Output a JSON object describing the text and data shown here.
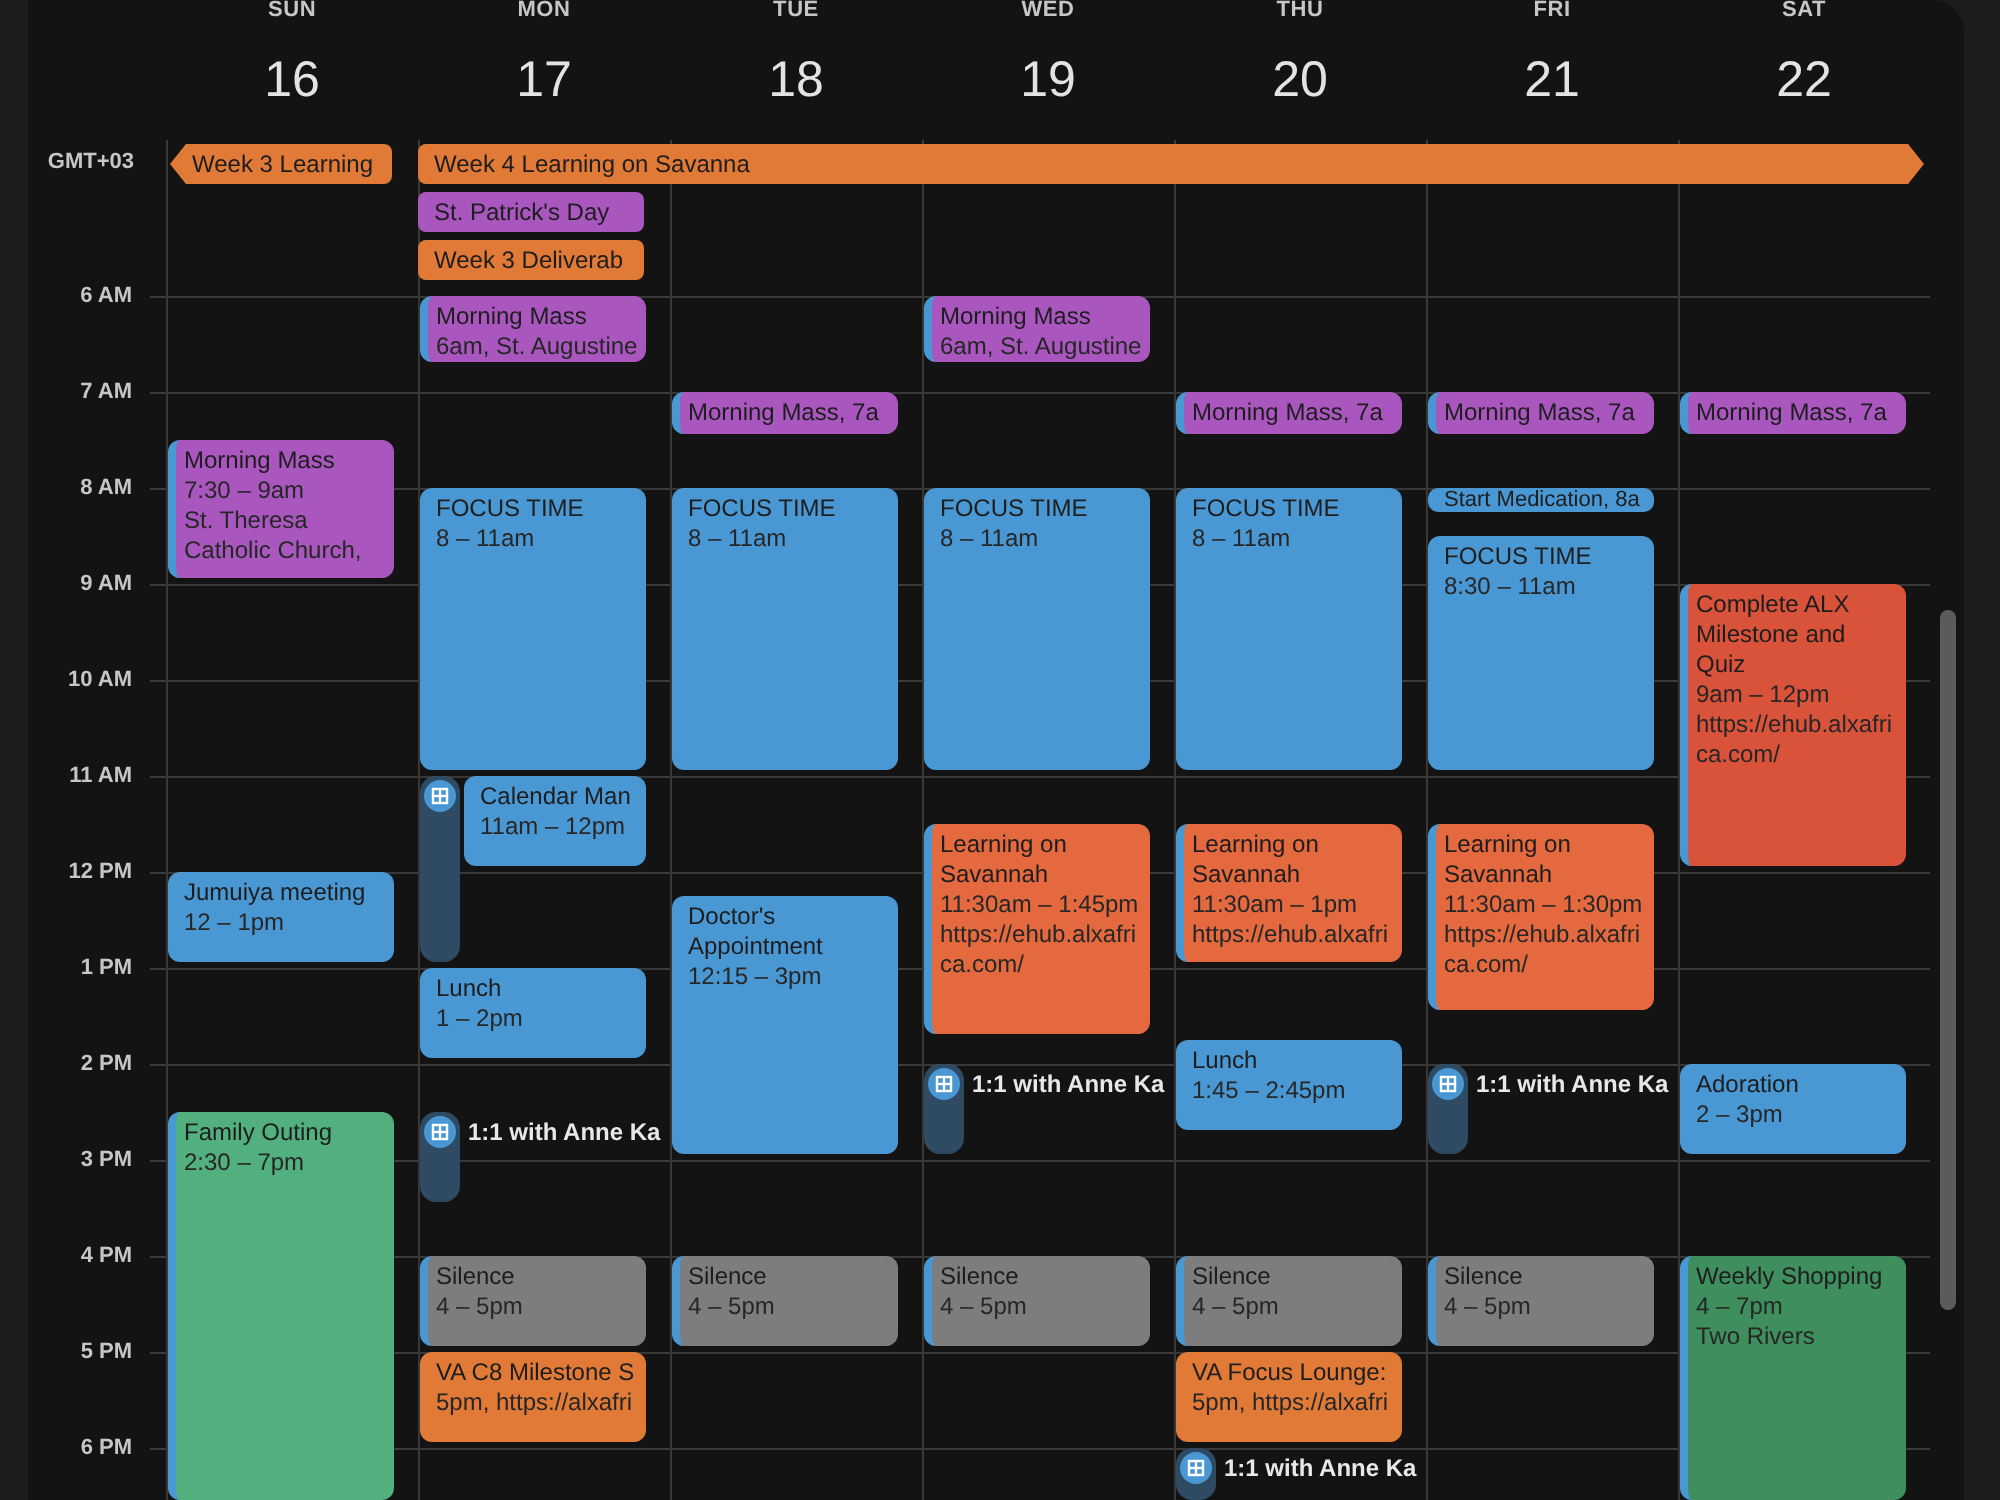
{
  "days": [
    {
      "weekday": "SUN",
      "date": "16",
      "events": [
        {
          "kind": "card",
          "title": "Morning Mass",
          "time": "7:30 – 9am",
          "location": "St. Theresa Catholic Church,",
          "color": "#a957bf",
          "stripe": true
        },
        {
          "kind": "card",
          "title": "Jumuiya meeting",
          "time": "12 – 1pm",
          "color": "#4a98d3"
        },
        {
          "kind": "card",
          "title": "Family Outing",
          "time": "2:30 – 7pm",
          "color": "#52b07e",
          "stripe": true
        }
      ]
    },
    {
      "weekday": "MON",
      "date": "17",
      "events": [
        {
          "kind": "card",
          "title": "Morning Mass",
          "time": "6am, St. Augustine",
          "color": "#a957bf",
          "stripe": true
        },
        {
          "kind": "card",
          "title": "FOCUS TIME",
          "time": "8 – 11am",
          "color": "#4a98d3"
        },
        {
          "kind": "booking"
        },
        {
          "kind": "card",
          "title": "Calendar Man",
          "time": "11am – 12pm",
          "color": "#4a98d3"
        },
        {
          "kind": "card",
          "title": "Lunch",
          "time": "1 – 2pm",
          "color": "#4a98d3"
        },
        {
          "kind": "booking",
          "title": "1:1 with Anne Ka"
        },
        {
          "kind": "card",
          "title": "Silence",
          "time": "4 – 5pm",
          "color": "#7d7d7d",
          "stripe": true
        },
        {
          "kind": "card",
          "title": "VA C8 Milestone S",
          "time": "5pm, https://alxafri",
          "color": "#e07a36",
          "stripe": false
        }
      ]
    },
    {
      "weekday": "TUE",
      "date": "18",
      "events": [
        {
          "kind": "chip",
          "title": "Morning Mass, 7a",
          "color": "#a957bf",
          "stripe": true
        },
        {
          "kind": "card",
          "title": "FOCUS TIME",
          "time": "8 – 11am",
          "color": "#4a98d3"
        },
        {
          "kind": "card",
          "title": "Doctor's Appointment",
          "time": "12:15 – 3pm",
          "color": "#4a98d3"
        },
        {
          "kind": "card",
          "title": "Silence",
          "time": "4 – 5pm",
          "color": "#7d7d7d",
          "stripe": true
        }
      ]
    },
    {
      "weekday": "WED",
      "date": "19",
      "events": [
        {
          "kind": "card",
          "title": "Morning Mass",
          "time": "6am, St. Augustine",
          "color": "#a957bf",
          "stripe": true
        },
        {
          "kind": "card",
          "title": "FOCUS TIME",
          "time": "8 – 11am",
          "color": "#4a98d3"
        },
        {
          "kind": "card",
          "title": "Learning on Savannah",
          "time": "11:30am – 1:45pm",
          "location": "https://ehub.alxafrica.com/",
          "color": "#e4693f",
          "stripe": true
        },
        {
          "kind": "booking",
          "title": "1:1 with Anne Ka"
        },
        {
          "kind": "card",
          "title": "Silence",
          "time": "4 – 5pm",
          "color": "#7d7d7d",
          "stripe": true
        }
      ]
    },
    {
      "weekday": "THU",
      "date": "20",
      "events": [
        {
          "kind": "chip",
          "title": "Morning Mass, 7a",
          "color": "#a957bf",
          "stripe": true
        },
        {
          "kind": "card",
          "title": "FOCUS TIME",
          "time": "8 – 11am",
          "color": "#4a98d3"
        },
        {
          "kind": "card",
          "title": "Learning on Savannah",
          "time": "11:30am – 1pm",
          "location": "https://ehub.alxafri",
          "color": "#e4693f",
          "stripe": true
        },
        {
          "kind": "card",
          "title": "Lunch",
          "time": "1:45 – 2:45pm",
          "color": "#4a98d3"
        },
        {
          "kind": "card",
          "title": "Silence",
          "time": "4 – 5pm",
          "color": "#7d7d7d",
          "stripe": true
        },
        {
          "kind": "card",
          "title": "VA Focus Lounge:",
          "time": "5pm, https://alxafri",
          "color": "#e07a36",
          "stripe": false
        },
        {
          "kind": "booking",
          "title": "1:1 with Anne Ka"
        }
      ]
    },
    {
      "weekday": "FRI",
      "date": "21",
      "events": [
        {
          "kind": "chip",
          "title": "Morning Mass, 7a",
          "color": "#a957bf",
          "stripe": true
        },
        {
          "kind": "chip",
          "title": "Start Medication, 8a",
          "color": "#4a98d3"
        },
        {
          "kind": "card",
          "title": "FOCUS TIME",
          "time": "8:30 – 11am",
          "color": "#4a98d3"
        },
        {
          "kind": "card",
          "title": "Learning on Savannah",
          "time": "11:30am – 1:30pm",
          "location": "https://ehub.alxafrica.com/",
          "color": "#e4693f",
          "stripe": true
        },
        {
          "kind": "booking",
          "title": "1:1 with Anne Ka"
        },
        {
          "kind": "card",
          "title": "Silence",
          "time": "4 – 5pm",
          "color": "#7d7d7d",
          "stripe": true
        }
      ]
    },
    {
      "weekday": "SAT",
      "date": "22",
      "events": [
        {
          "kind": "chip",
          "title": "Morning Mass, 7a",
          "color": "#a957bf",
          "stripe": true
        },
        {
          "kind": "card",
          "title": "Complete ALX Milestone and Quiz",
          "time": "9am – 12pm",
          "location": "https://ehub.alxafrica.com/",
          "color": "#d9523a",
          "stripe": true
        },
        {
          "kind": "card",
          "title": "Adoration",
          "time": "2 – 3pm",
          "color": "#4a98d3"
        },
        {
          "kind": "card",
          "title": "Weekly Shopping",
          "time": "4 – 7pm",
          "location": "Two Rivers",
          "color": "#3f8e5d",
          "stripe": true
        }
      ]
    }
  ],
  "timezone": "GMT+03",
  "all_day_events": [
    {
      "title": "Week 3 Learning",
      "color": "#e07a36",
      "continues_before": true,
      "continues_after": false
    },
    {
      "title": "Week 4 Learning on Savanna",
      "color": "#e07a36",
      "continues_before": false,
      "continues_after": true
    },
    {
      "title": "St. Patrick's Day",
      "color": "#a957bf",
      "continues_before": false,
      "continues_after": false
    },
    {
      "title": "Week 3 Deliverab",
      "color": "#e07a36",
      "continues_before": false,
      "continues_after": false
    }
  ],
  "hours": [
    "6 AM",
    "7 AM",
    "8 AM",
    "9 AM",
    "10 AM",
    "11 AM",
    "12 PM",
    "1 PM",
    "2 PM",
    "3 PM",
    "4 PM",
    "5 PM",
    "6 PM"
  ]
}
